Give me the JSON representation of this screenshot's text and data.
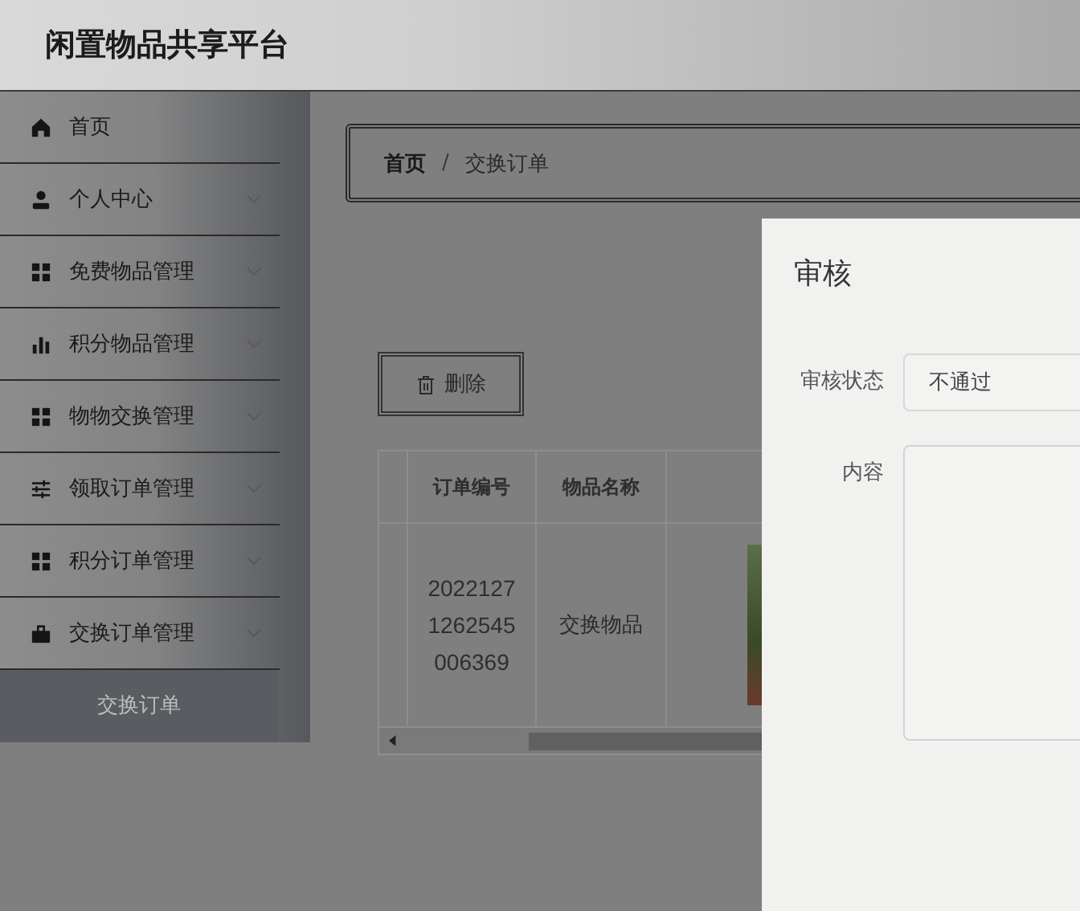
{
  "header": {
    "title": "闲置物品共享平台"
  },
  "sidebar": {
    "items": [
      {
        "label": "首页",
        "kind": "home",
        "expandable": false
      },
      {
        "label": "个人中心",
        "kind": "user",
        "expandable": true
      },
      {
        "label": "免费物品管理",
        "kind": "grid",
        "expandable": true
      },
      {
        "label": "积分物品管理",
        "kind": "bars",
        "expandable": true
      },
      {
        "label": "物物交换管理",
        "kind": "grid",
        "expandable": true
      },
      {
        "label": "领取订单管理",
        "kind": "sliders",
        "expandable": true
      },
      {
        "label": "积分订单管理",
        "kind": "grid",
        "expandable": true
      },
      {
        "label": "交换订单管理",
        "kind": "bag",
        "expandable": true,
        "children": [
          {
            "label": "交换订单",
            "selected": true
          }
        ]
      }
    ]
  },
  "breadcrumb": {
    "separator": "/",
    "items": [
      {
        "label": "首页"
      },
      {
        "label": "交换订单"
      }
    ]
  },
  "toolbar": {
    "delete_button": "删除"
  },
  "table": {
    "columns": [
      "订单编号",
      "物品名称"
    ],
    "rows": [
      {
        "order_no": "20221271262545006369",
        "item_name": "交换物品"
      }
    ]
  },
  "dialog": {
    "title": "审核",
    "fields": [
      {
        "kind": "select",
        "label": "审核状态",
        "value": "不通过"
      },
      {
        "kind": "textarea",
        "label": "内容"
      }
    ]
  }
}
